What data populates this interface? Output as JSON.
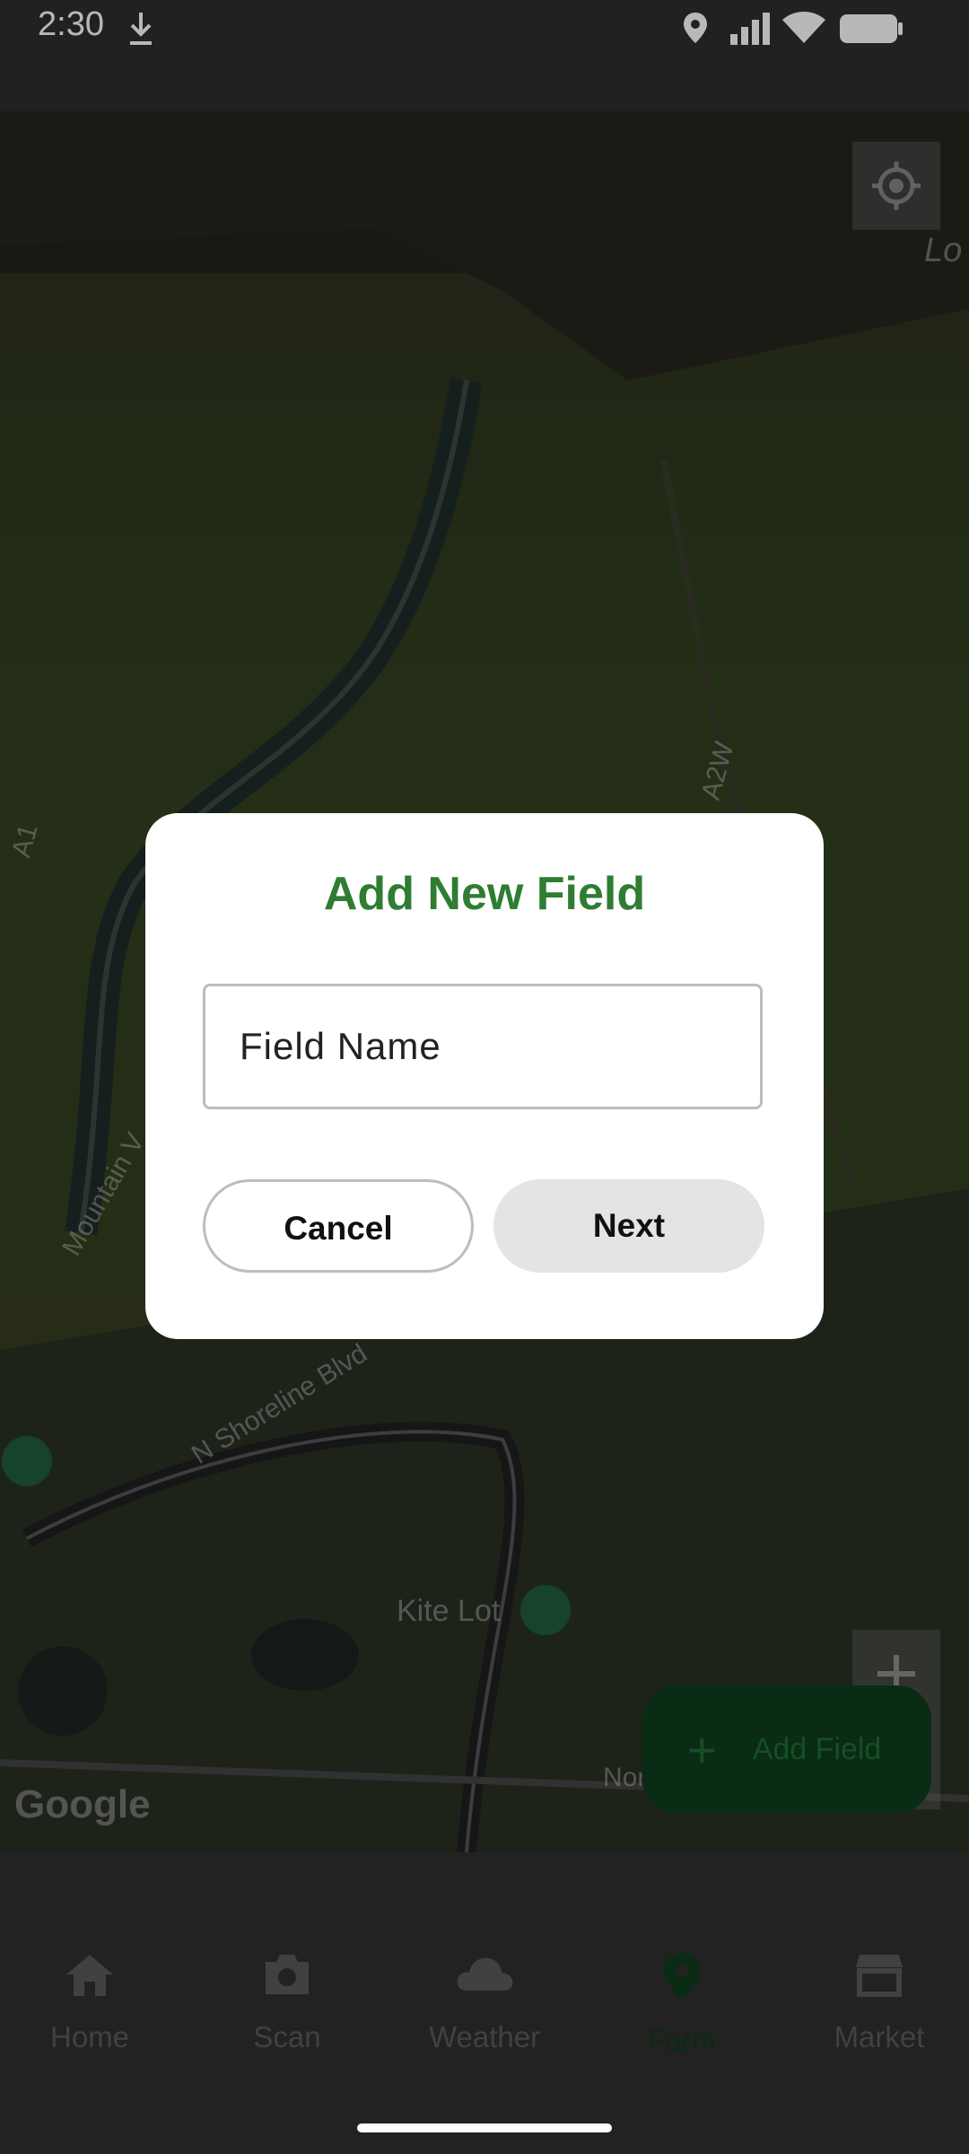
{
  "status_bar": {
    "time": "2:30",
    "icons": [
      "download-icon",
      "location-icon",
      "signal-icon",
      "wifi-icon",
      "battery-icon"
    ]
  },
  "map": {
    "labels": {
      "road_a2w": "A2W",
      "road_a1": "A1",
      "mountain": "Mountain V",
      "shoreline": "N Shoreline Blvd",
      "kite_lot": "Kite Lot",
      "top_right": "Lo",
      "bottom_right": "Nor"
    },
    "attribution": "Google"
  },
  "fab": {
    "label": "Add Field"
  },
  "dialog": {
    "title": "Add New Field",
    "field_placeholder": "Field Name",
    "cancel_label": "Cancel",
    "next_label": "Next",
    "title_color": "#2e7d32"
  },
  "nav": {
    "items": [
      {
        "label": "Home",
        "icon": "home-icon"
      },
      {
        "label": "Scan",
        "icon": "camera-icon"
      },
      {
        "label": "Weather",
        "icon": "cloud-icon"
      },
      {
        "label": "Farm",
        "icon": "location-pin-icon",
        "active": true
      },
      {
        "label": "Market",
        "icon": "store-icon"
      }
    ],
    "active_color": "#0f3c1d"
  }
}
